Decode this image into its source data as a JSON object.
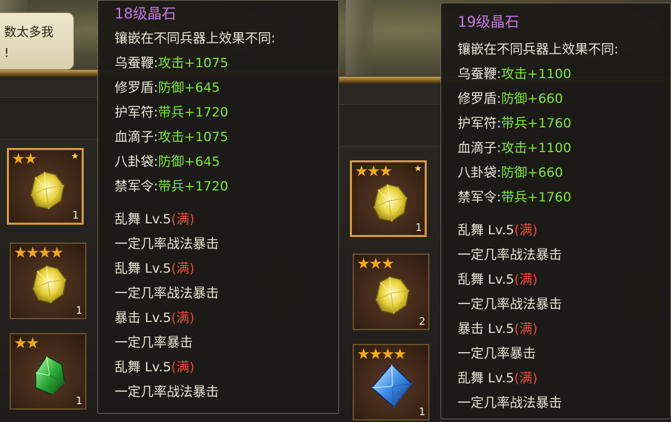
{
  "left": {
    "speech_text_line1": "数太多我",
    "speech_text_line2": "!",
    "tooltip": {
      "title": "18级晶石",
      "subtitle": "镶嵌在不同兵器上效果不同:",
      "bonuses": [
        {
          "weapon": "乌蚕鞭:",
          "effect": "攻击+1075"
        },
        {
          "weapon": "修罗盾:",
          "effect": "防御+645"
        },
        {
          "weapon": "护军符:",
          "effect": "带兵+1720"
        },
        {
          "weapon": "血滴子:",
          "effect": "攻击+1075"
        },
        {
          "weapon": "八卦袋:",
          "effect": "防御+645"
        },
        {
          "weapon": "禁军令:",
          "effect": "带兵+1720"
        }
      ],
      "skills": [
        {
          "name": "乱舞 Lv.5",
          "status": "(满)",
          "desc": "一定几率战法暴击"
        },
        {
          "name": "乱舞 Lv.5",
          "status": "(满)",
          "desc": "一定几率战法暴击"
        },
        {
          "name": "暴击 Lv.5",
          "status": "(满)",
          "desc": "一定几率暴击"
        },
        {
          "name": "乱舞 Lv.5",
          "status": "(满)",
          "desc": "一定几率战法暴击"
        }
      ]
    },
    "items": [
      {
        "stars": "★★",
        "qty": "1",
        "gem": "yellow-crystal"
      },
      {
        "stars": "★★★★",
        "qty": "1",
        "gem": "yellow-crystal"
      },
      {
        "stars": "★★",
        "qty": "1",
        "gem": "green-crystal"
      }
    ]
  },
  "right": {
    "tooltip": {
      "title": "19级晶石",
      "subtitle": "镶嵌在不同兵器上效果不同:",
      "bonuses": [
        {
          "weapon": "乌蚕鞭:",
          "effect": "攻击+1100"
        },
        {
          "weapon": "修罗盾:",
          "effect": "防御+660"
        },
        {
          "weapon": "护军符:",
          "effect": "带兵+1760"
        },
        {
          "weapon": "血滴子:",
          "effect": "攻击+1100"
        },
        {
          "weapon": "八卦袋:",
          "effect": "防御+660"
        },
        {
          "weapon": "禁军令:",
          "effect": "带兵+1760"
        }
      ],
      "skills": [
        {
          "name": "乱舞 Lv.5",
          "status": "(满)",
          "desc": "一定几率战法暴击"
        },
        {
          "name": "乱舞 Lv.5",
          "status": "(满)",
          "desc": "一定几率战法暴击"
        },
        {
          "name": "暴击 Lv.5",
          "status": "(满)",
          "desc": "一定几率暴击"
        },
        {
          "name": "乱舞 Lv.5",
          "status": "(满)",
          "desc": "一定几率战法暴击"
        }
      ]
    },
    "items": [
      {
        "stars": "★★★",
        "qty": "1",
        "gem": "yellow-crystal"
      },
      {
        "stars": "★★★",
        "qty": "2",
        "gem": "yellow-crystal"
      },
      {
        "stars": "★★★★",
        "qty": "1",
        "gem": "blue-crystal"
      }
    ]
  },
  "colors": {
    "title": "#c476e6",
    "effect": "#7ee640",
    "maxed": "#ea4a3a",
    "text": "#e8e4d8",
    "star": "#f2a81e"
  }
}
